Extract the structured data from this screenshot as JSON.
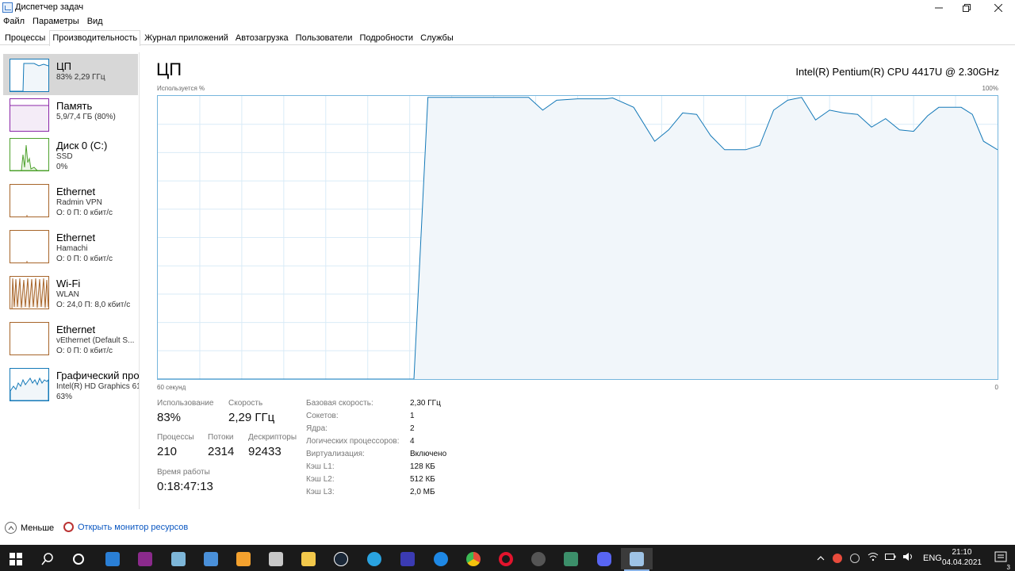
{
  "window": {
    "title": "Диспетчер задач"
  },
  "menu": [
    "Файл",
    "Параметры",
    "Вид"
  ],
  "tabs": [
    "Процессы",
    "Производительность",
    "Журнал приложений",
    "Автозагрузка",
    "Пользователи",
    "Подробности",
    "Службы"
  ],
  "active_tab": "Производительность",
  "sidebar": [
    {
      "title": "ЦП",
      "line2": "83% 2,29 ГГц",
      "line3": "",
      "color": "#1479b8"
    },
    {
      "title": "Память",
      "line2": "5,9/7,4 ГБ (80%)",
      "line3": "",
      "color": "#8b27a8"
    },
    {
      "title": "Диск 0 (C:)",
      "line2": "SSD",
      "line3": "0%",
      "color": "#4da12c"
    },
    {
      "title": "Ethernet",
      "line2": "Radmin VPN",
      "line3": "О: 0 П: 0 кбит/с",
      "color": "#a7652a"
    },
    {
      "title": "Ethernet",
      "line2": "Hamachi",
      "line3": "О: 0 П: 0 кбит/с",
      "color": "#a7652a"
    },
    {
      "title": "Wi-Fi",
      "line2": "WLAN",
      "line3": "О: 24,0 П: 8,0 кбит/с",
      "color": "#a7652a"
    },
    {
      "title": "Ethernet",
      "line2": "vEthernet (Default S...",
      "line3": "О: 0 П: 0 кбит/с",
      "color": "#a7652a"
    },
    {
      "title": "Графический процессор",
      "line2": "Intel(R) HD Graphics 61",
      "line3": "63%",
      "color": "#1479b8"
    }
  ],
  "main": {
    "heading": "ЦП",
    "cpu_model": "Intel(R) Pentium(R) CPU 4417U @ 2.30GHz",
    "graph_top_left": "Используется %",
    "graph_top_right": "100%",
    "graph_bottom_left": "60 секунд",
    "graph_bottom_right": "0"
  },
  "chart_data": {
    "type": "area",
    "title": "",
    "xlabel": "60 секунд",
    "ylabel": "Используется %",
    "xlim": [
      0,
      60
    ],
    "ylim": [
      0,
      100
    ],
    "grid": true,
    "color": "#1479b8",
    "fill": "#f1f6fa",
    "x": [
      0,
      18.3,
      19.3,
      21,
      24,
      26.5,
      27.5,
      28.5,
      30,
      32,
      32.5,
      34,
      35.5,
      36.5,
      37.5,
      38.5,
      39.5,
      40.5,
      42,
      43,
      44,
      45,
      46,
      47,
      48,
      49,
      50,
      51,
      52,
      53,
      54,
      55,
      55.8,
      56.6,
      57.4,
      58.2,
      59,
      60
    ],
    "y": [
      0,
      0,
      99.5,
      99.5,
      99.5,
      99.5,
      95,
      98.5,
      99,
      99,
      99.3,
      96,
      84,
      88,
      94,
      93.5,
      86,
      81,
      81,
      82.5,
      95,
      98.5,
      99.5,
      91.5,
      95,
      94,
      93.5,
      89,
      92,
      88,
      87.5,
      93,
      96,
      96,
      96,
      93.5,
      84,
      81
    ]
  },
  "stats": {
    "usage": {
      "label": "Использование",
      "value": "83%"
    },
    "speed": {
      "label": "Скорость",
      "value": "2,29 ГГц"
    },
    "processes": {
      "label": "Процессы",
      "value": "210"
    },
    "threads": {
      "label": "Потоки",
      "value": "2314"
    },
    "handles": {
      "label": "Дескрипторы",
      "value": "92433"
    },
    "uptime": {
      "label": "Время работы",
      "value": "0:18:47:13"
    }
  },
  "details": [
    {
      "k": "Базовая скорость:",
      "v": "2,30 ГГц"
    },
    {
      "k": "Сокетов:",
      "v": "1"
    },
    {
      "k": "Ядра:",
      "v": "2"
    },
    {
      "k": "Логических процессоров:",
      "v": "4"
    },
    {
      "k": "Виртуализация:",
      "v": "Включено"
    },
    {
      "k": "Кэш L1:",
      "v": "128 КБ"
    },
    {
      "k": "Кэш L2:",
      "v": "512 КБ"
    },
    {
      "k": "Кэш L3:",
      "v": "2,0 МБ"
    }
  ],
  "footer": {
    "less_label": "Меньше",
    "resource_monitor": "Открыть монитор ресурсов"
  },
  "taskbar": {
    "icons": [
      {
        "name": "start-icon",
        "color": "#ffffff"
      },
      {
        "name": "search-icon",
        "color": "#ffffff"
      },
      {
        "name": "task-view-icon",
        "color": "#ffffff"
      },
      {
        "name": "mail-icon",
        "color": "#2a7fd6"
      },
      {
        "name": "winrar-icon",
        "color": "#8b2a8c"
      },
      {
        "name": "notepad-icon",
        "color": "#7db6d8"
      },
      {
        "name": "folder-shortcut-icon",
        "color": "#4a90d9"
      },
      {
        "name": "sublime-icon",
        "color": "#f4a12e"
      },
      {
        "name": "app-icon",
        "color": "#c8c8c8"
      },
      {
        "name": "explorer-icon",
        "color": "#f2c84b"
      },
      {
        "name": "steam-icon",
        "color": "#1b2838"
      },
      {
        "name": "telegram-icon",
        "color": "#2aa3e0"
      },
      {
        "name": "monitor-app-icon",
        "color": "#3b3bb3"
      },
      {
        "name": "network-app-icon",
        "color": "#1e88e5"
      },
      {
        "name": "chrome-icon",
        "color": "#e44d3a"
      },
      {
        "name": "opera-icon",
        "color": "#e3142d"
      },
      {
        "name": "media-icon",
        "color": "#555555"
      },
      {
        "name": "game-icon",
        "color": "#3c8f6a"
      },
      {
        "name": "discord-icon",
        "color": "#5865f2"
      },
      {
        "name": "task-manager-icon",
        "color": "#9ec3e6"
      }
    ],
    "lang": "ENG",
    "time": "21:10",
    "date": "04.04.2021",
    "notifications": "3"
  }
}
